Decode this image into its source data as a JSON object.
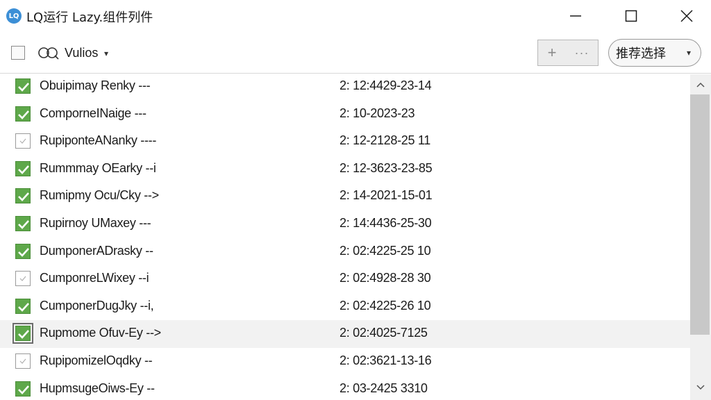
{
  "window": {
    "logo_text": "LQ",
    "title": "LQ运行 Lazy.组件列件",
    "controls": {
      "minimize": "—",
      "maximize": "☐",
      "close": "✕"
    }
  },
  "toolbar": {
    "user_label": "Vulios",
    "user_caret": "▾",
    "plus_label": "+",
    "more_label": "···",
    "select_label": "推荐选择",
    "select_caret": "▾"
  },
  "rows": [
    {
      "name": "Obuipimay Renky ---",
      "time": "2: 12:4429-23-14",
      "checked": true
    },
    {
      "name": "ComporneINaige ---",
      "time": "2: 10-2023-23",
      "checked": true
    },
    {
      "name": "RupiponteANanky ----",
      "time": "2: 12-2128-25 11",
      "checked": false
    },
    {
      "name": "Rummmay OEarky --i",
      "time": "2: 12-3623-23-85",
      "checked": true
    },
    {
      "name": "Rumipmy Ocu/Cky -->",
      "time": "2: 14-2021-15-01",
      "checked": true
    },
    {
      "name": "Rupirnoy UMaxey ---",
      "time": "2: 14:4436-25-30",
      "checked": true
    },
    {
      "name": "DumponerADrasky --",
      "time": "2: 02:4225-25 10",
      "checked": true
    },
    {
      "name": "CumponreLWixey --i",
      "time": "2: 02:4928-28 30",
      "checked": false
    },
    {
      "name": "CumponerDugJky --i,",
      "time": "2: 02:4225-26 10",
      "checked": true
    },
    {
      "name": "Rupmome Ofuv-Ey -->",
      "time": "2: 02:4025-7125",
      "checked": true,
      "focused": true
    },
    {
      "name": "RupipomizelOqdky --",
      "time": "2: 02:3621-13-16",
      "checked": false
    },
    {
      "name": "HupmsugeOiws-Ey --",
      "time": "2: 03-2425 3310",
      "checked": true
    }
  ],
  "scrollbar": {
    "up_arrow": "⌃",
    "down_arrow": "⌄"
  },
  "colors": {
    "check_green": "#5ea84a",
    "logo_blue": "#3c8fd6"
  }
}
